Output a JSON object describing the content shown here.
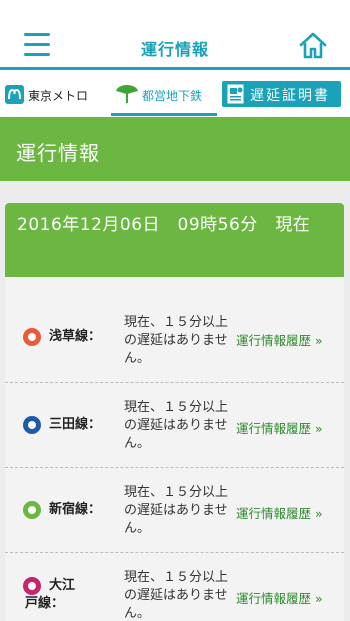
{
  "header": {
    "title": "運行情報",
    "menu_icon": "hamburger-menu-icon",
    "home_icon": "home-icon"
  },
  "tabs": [
    {
      "label": "東京メトロ",
      "icon": "tokyo-metro-logo-icon",
      "active": false
    },
    {
      "label": "都営地下鉄",
      "icon": "ginkgo-leaf-icon",
      "active": true
    },
    {
      "label": "遅延証明書",
      "icon": "document-icon",
      "active": false
    }
  ],
  "band": {
    "title": "運行情報"
  },
  "card": {
    "datetime": "2016年12月06日　09時56分　現在"
  },
  "lines": [
    {
      "name": "浅草線：",
      "color": "#e85a3a",
      "status": "現在、１５分以上の遅延はありません。",
      "history_label": "運行情報履歴 »"
    },
    {
      "name": "三田線：",
      "color": "#1e5aa8",
      "status": "現在、１５分以上の遅延はありません。",
      "history_label": "運行情報履歴 »"
    },
    {
      "name": "新宿線：",
      "color": "#6cb742",
      "status": "現在、１５分以上の遅延はありません。",
      "history_label": "運行情報履歴 »"
    },
    {
      "name": "大江戸線：",
      "color": "#c8246c",
      "status": "現在、１５分以上の遅延はありません。",
      "history_label": "運行情報履歴 »"
    }
  ],
  "colors": {
    "accent": "#1aa3b8",
    "green": "#6cb742",
    "link_green": "#2e8a2e"
  }
}
